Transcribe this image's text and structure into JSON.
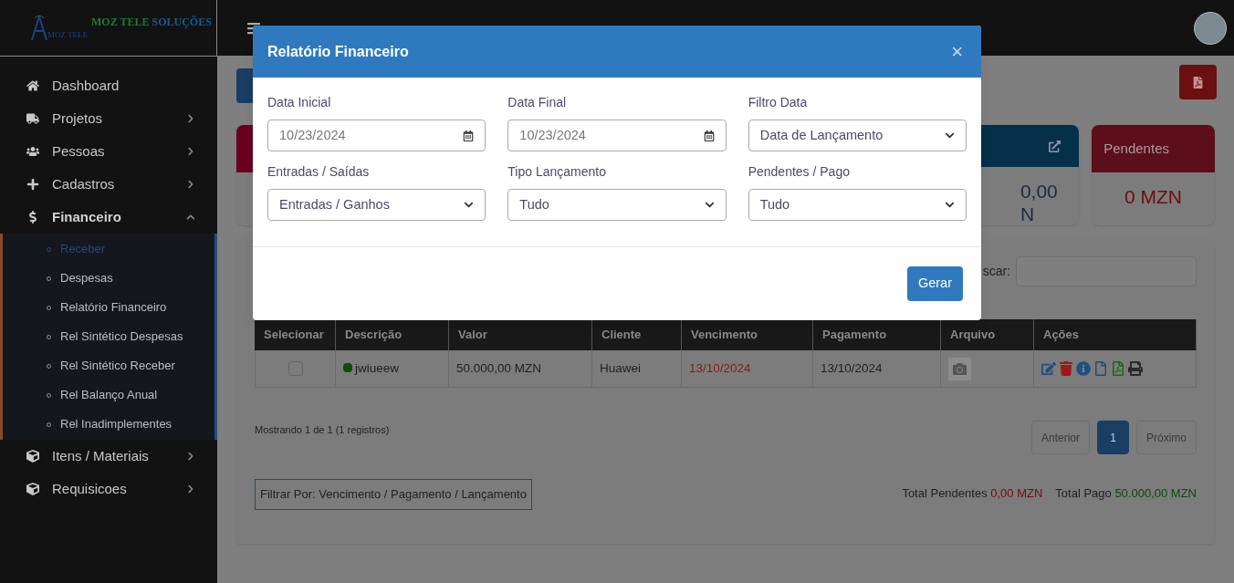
{
  "sidebar": {
    "logo": {
      "title_1": "MOZ TELE",
      "title_2": "SOLUÇÕES",
      "mark": "MOZ TELE"
    },
    "items": [
      {
        "label": "Dashboard",
        "kind": "link",
        "selected": false
      },
      {
        "label": "Projetos",
        "kind": "menu",
        "expanded": false,
        "selected": false
      },
      {
        "label": "Pessoas",
        "kind": "menu",
        "expanded": false,
        "selected": false
      },
      {
        "label": "Cadastros",
        "kind": "menu",
        "expanded": false,
        "selected": false
      },
      {
        "label": "Financeiro",
        "kind": "menu",
        "expanded": true,
        "selected": true,
        "children": [
          {
            "label": "Receber",
            "selected": true
          },
          {
            "label": "Despesas",
            "selected": false
          },
          {
            "label": "Relatório Financeiro",
            "selected": false
          },
          {
            "label": "Rel Sintético Despesas",
            "selected": false
          },
          {
            "label": "Rel Sintético Receber",
            "selected": false
          },
          {
            "label": "Rel Balanço Anual",
            "selected": false
          },
          {
            "label": "Rel Inadimplementes",
            "selected": false
          }
        ]
      },
      {
        "label": "Itens / Materiais",
        "kind": "menu",
        "expanded": false,
        "selected": false
      },
      {
        "label": "Requisicoes",
        "kind": "menu",
        "expanded": false,
        "selected": false
      }
    ]
  },
  "cards": [
    {
      "color": "#6a0020"
    },
    {
      "value_lines": [
        "0,00",
        "N"
      ],
      "color": "#05304a"
    },
    {
      "title": "Pendentes",
      "value_lines": [
        "0 MZN"
      ],
      "color": "#5c0f1a"
    }
  ],
  "search": {
    "label": "scar:"
  },
  "table": {
    "columns": [
      "Selecionar",
      "Descrição",
      "Valor",
      "Cliente",
      "Vencimento",
      "Pagamento",
      "Arquivo",
      "Ações"
    ],
    "rows": [
      {
        "selected": false,
        "color": "#0b4d0b",
        "descricao": "jwiueew",
        "valor": "50.000,00 MZN",
        "cliente": "Huawei",
        "vencimento": "13/10/2024",
        "overdue": true,
        "pagamento": "13/10/2024"
      }
    ]
  },
  "info": "Mostrando 1 de 1 (1 registros)",
  "pagination": [
    {
      "label": "Anterior",
      "selected": false
    },
    {
      "label": "1",
      "selected": true
    },
    {
      "label": "Próximo",
      "selected": false
    }
  ],
  "filter_note": "Filtrar Por: Vencimento / Pagamento / Lançamento",
  "totals": [
    {
      "label": "Total Pendentes",
      "value": "0,00 MZN",
      "kind": "pending"
    },
    {
      "label": "Total Pago",
      "value": "50.000,00 MZN",
      "kind": "paid"
    }
  ],
  "modal": {
    "title": "Relatório Financeiro",
    "close": "×",
    "fields": [
      {
        "kind": "date",
        "label": "Data Inicial",
        "value": "10/23/2024"
      },
      {
        "kind": "date",
        "label": "Data Final",
        "value": "10/23/2024"
      },
      {
        "kind": "select",
        "label": "Filtro Data",
        "value": "Data de Lançamento"
      },
      {
        "kind": "select",
        "label": "Entradas / Saídas",
        "value": "Entradas / Ganhos"
      },
      {
        "kind": "select",
        "label": "Tipo Lançamento",
        "value": "Tudo"
      },
      {
        "kind": "select",
        "label": "Pendentes / Pago",
        "value": "Tudo"
      }
    ],
    "button": "Gerar"
  }
}
